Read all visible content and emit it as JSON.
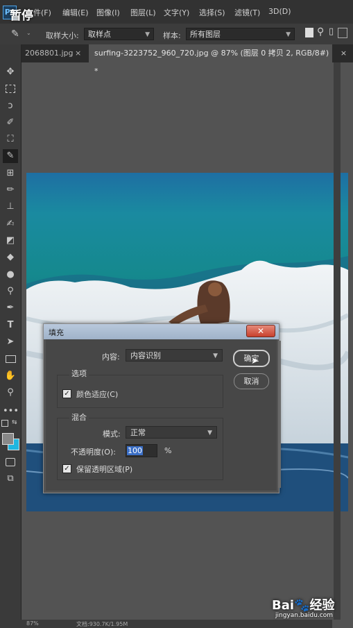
{
  "overlay": {
    "pause_label": "暂停",
    "app_logo": "Ps"
  },
  "menu": {
    "items": [
      "文件(F)",
      "编辑(E)",
      "图像(I)",
      "图层(L)",
      "文字(Y)",
      "选择(S)",
      "滤镜(T)",
      "3D(D)"
    ]
  },
  "options_bar": {
    "sample_size_label": "取样大小:",
    "sample_size_value": "取样点",
    "sample_label": "样本:",
    "sample_value": "所有图层"
  },
  "tabs": [
    {
      "label": "2068801.jpg",
      "close": "×"
    },
    {
      "label": "surfing-3223752_960_720.jpg @ 87% (图层 0 拷贝 2, RGB/8#) *",
      "close": "×"
    }
  ],
  "status": {
    "zoom": "87%",
    "doc": "文档:930.7K/1.95M"
  },
  "watermark": {
    "logo": "Bai🐾经验",
    "url": "jingyan.baidu.com"
  },
  "dialog": {
    "title": "填充",
    "close_symbol": "✕",
    "content_label": "内容:",
    "content_value": "内容识别",
    "ok_label": "确定",
    "cancel_label": "取消",
    "options_group_label": "选项",
    "color_adaptation_label": "颜色适应(C)",
    "color_adaptation_checked": true,
    "blend_group_label": "混合",
    "mode_label": "模式:",
    "mode_value": "正常",
    "opacity_label": "不透明度(O):",
    "opacity_value": "100",
    "opacity_unit": "%",
    "preserve_transparency_label": "保留透明区域(P)",
    "preserve_transparency_checked": true
  },
  "colors": {
    "accent": "#3b6fc7",
    "dialog_title_bg": "#a9bbd1",
    "close_button": "#c8402d",
    "sea": "#1f8a9a"
  }
}
